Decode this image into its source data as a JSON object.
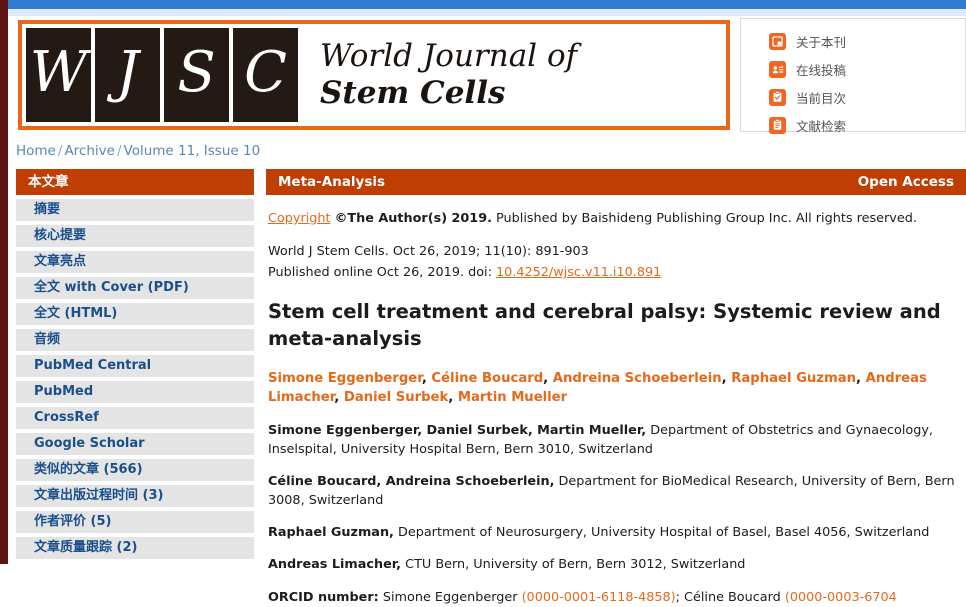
{
  "topbar": {
    "accent_blue": "#2f7bd0",
    "accent_orange": "#e8681a",
    "header_rust": "#bf3e04"
  },
  "masthead": {
    "logo_letters": [
      "W",
      "J",
      "S",
      "C"
    ],
    "title_line1": "World Journal of",
    "title_line2": "Stem Cells"
  },
  "nav_box": {
    "items": [
      {
        "icon": "about-journal-icon",
        "label": "关于本刊"
      },
      {
        "icon": "online-submission-icon",
        "label": "在线投稿"
      },
      {
        "icon": "current-issue-icon",
        "label": "当前目次"
      },
      {
        "icon": "literature-search-icon",
        "label": "文献检索"
      }
    ]
  },
  "breadcrumb": {
    "items": [
      "Home",
      "Archive",
      "Volume 11, Issue 10"
    ],
    "separator": "/"
  },
  "sidebar": {
    "header": "本文章",
    "items": [
      "摘要",
      "核心提要",
      "文章亮点",
      "全文 with Cover (PDF)",
      "全文 (HTML)",
      "音频",
      "PubMed Central",
      "PubMed",
      "CrossRef",
      "Google Scholar",
      "类似的文章 (566)",
      "文章出版过程时间 (3)",
      "作者评价 (5)",
      "文章质量跟踪 (2)"
    ]
  },
  "main": {
    "article_type": "Meta-Analysis",
    "access_badge": "Open Access",
    "copyright": {
      "link_text": "Copyright",
      "holder": "©The Author(s) 2019.",
      "rest": " Published by Baishideng Publishing Group Inc. All rights reserved."
    },
    "citation": "World J Stem Cells. Oct 26, 2019; 11(10): 891-903",
    "published_prefix": "Published online Oct 26, 2019. doi: ",
    "doi": "10.4252/wjsc.v11.i10.891",
    "title": "Stem cell treatment and cerebral palsy: Systemic review and meta-analysis",
    "authors": [
      "Simone Eggenberger",
      "Céline Boucard",
      "Andreina Schoeberlein",
      "Raphael Guzman",
      "Andreas Limacher",
      "Daniel Surbek",
      "Martin Mueller"
    ],
    "affiliations": [
      {
        "names": "Simone Eggenberger, Daniel Surbek, Martin Mueller,",
        "text": " Department of Obstetrics and Gynaecology, Inselspital, University Hospital Bern, Bern 3010, Switzerland"
      },
      {
        "names": "Céline Boucard, Andreina Schoeberlein,",
        "text": " Department for BioMedical Research, University of Bern, Bern 3008, Switzerland"
      },
      {
        "names": "Raphael Guzman,",
        "text": " Department of Neurosurgery, University Hospital of Basel, Basel 4056, Switzerland"
      },
      {
        "names": "Andreas Limacher,",
        "text": " CTU Bern, University of Bern, Bern 3012, Switzerland"
      }
    ],
    "orcid": {
      "label": "ORCID number:",
      "entry1_name": " Simone Eggenberger ",
      "entry1_id": "(0000-0001-6118-4858)",
      "entry2_name": "; Céline Boucard ",
      "entry2_id": "(0000-0003-6704"
    }
  }
}
